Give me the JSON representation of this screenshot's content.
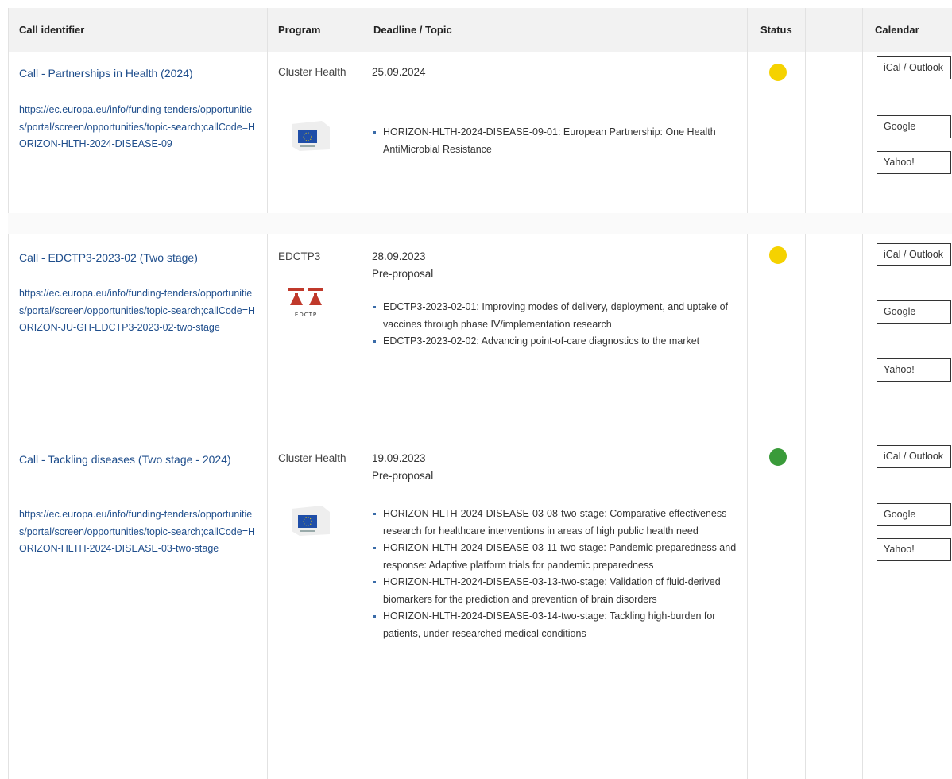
{
  "columns": {
    "call": "Call identifier",
    "program": "Program",
    "deadline": "Deadline / Topic",
    "status": "Status",
    "calendar": "Calendar"
  },
  "calendar_buttons": {
    "ical": "iCal / Outlook",
    "google": "Google",
    "yahoo": "Yahoo!"
  },
  "status_colors": {
    "open_soon": "#f5d200",
    "open": "#3a9b3a"
  },
  "rows": [
    {
      "title": "Call - Partnerships in Health (2024)",
      "url": "https://ec.europa.eu/info/funding-tenders/opportunities/portal/screen/opportunities/topic-search;callCode=HORIZON-HLTH-2024-DISEASE-09",
      "program": "Cluster Health",
      "program_logo": "eu-commission-logo",
      "deadline": "25.09.2024",
      "stage": "",
      "status": "yellow",
      "topics": [
        "HORIZON-HLTH-2024-DISEASE-09-01: European Partnership: One Health AntiMicrobial Resistance"
      ]
    },
    {
      "title": "Call - EDCTP3-2023-02 (Two stage)",
      "url": "https://ec.europa.eu/info/funding-tenders/opportunities/portal/screen/opportunities/topic-search;callCode=HORIZON-JU-GH-EDCTP3-2023-02-two-stage",
      "program": "EDCTP3",
      "program_logo": "edctp-logo",
      "program_logo_text": "EDCTP",
      "deadline": "28.09.2023",
      "stage": "Pre-proposal",
      "status": "yellow",
      "topics": [
        "EDCTP3-2023-02-01: Improving modes of delivery, deployment, and uptake of vaccines through phase IV/implementation research",
        "EDCTP3-2023-02-02: Advancing point-of-care diagnostics to the market"
      ]
    },
    {
      "title": "Call - Tackling diseases (Two stage - 2024)",
      "url": "https://ec.europa.eu/info/funding-tenders/opportunities/portal/screen/opportunities/topic-search;callCode=HORIZON-HLTH-2024-DISEASE-03-two-stage",
      "program": "Cluster Health",
      "program_logo": "eu-commission-logo",
      "deadline": "19.09.2023",
      "stage": "Pre-proposal",
      "status": "green",
      "topics": [
        "HORIZON-HLTH-2024-DISEASE-03-08-two-stage: Comparative effectiveness research for healthcare interventions in areas of high public health need",
        "HORIZON-HLTH-2024-DISEASE-03-11-two-stage: Pandemic preparedness and response: Adaptive platform trials for pandemic preparedness",
        "HORIZON-HLTH-2024-DISEASE-03-13-two-stage: Validation of fluid-derived biomarkers for the prediction and prevention of brain disorders",
        "HORIZON-HLTH-2024-DISEASE-03-14-two-stage: Tackling high-burden for patients, under-researched medical conditions"
      ]
    }
  ]
}
